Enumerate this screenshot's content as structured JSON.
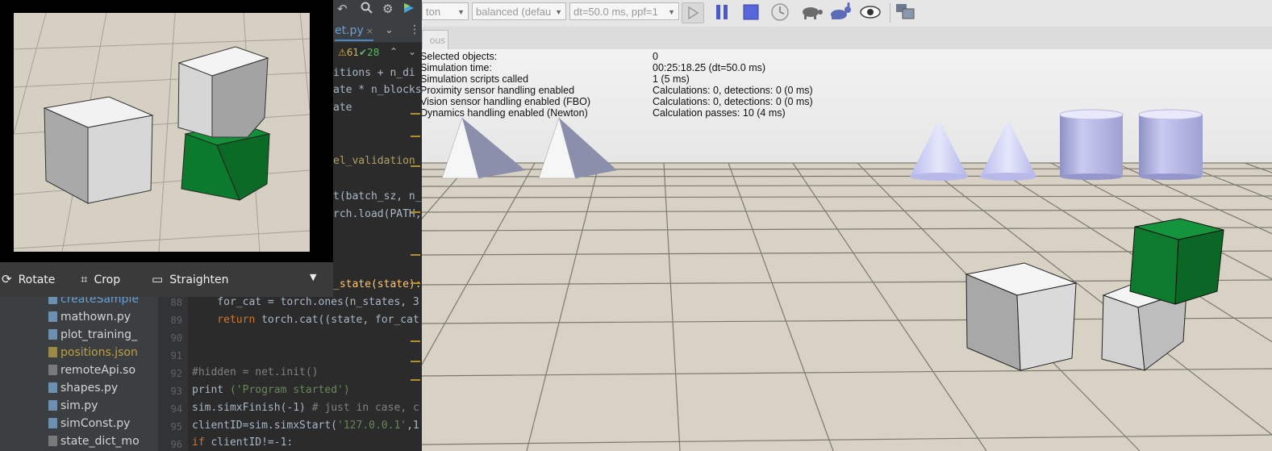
{
  "ide": {
    "file_tab": "et.py",
    "tab_close": "×",
    "warning_count": "61",
    "ok_count": "28",
    "code_lines": [
      {
        "text": "itions + n_di"
      },
      {
        "text": "ate * n_blocks"
      },
      {
        "text": "ate"
      },
      {
        "text": "el_validation"
      },
      {
        "text": "t(batch_sz, n_"
      },
      {
        "text": "rch.load(PATH,"
      },
      {
        "text": "_state(state):"
      }
    ],
    "line_numbers": [
      "88",
      "89",
      "90",
      "91",
      "92",
      "93",
      "94",
      "95",
      "96"
    ],
    "code_88": "    for_cat = torch.ones(n_states, 3",
    "code_89_kw": "    return",
    "code_89_rest": " torch.cat((state, for_cat",
    "code_92": "#hidden = net.init()",
    "code_93_fn": "print",
    "code_93_str": " ('Program started')",
    "code_94_a": "sim.simxFinish(-1)",
    "code_94_cm": " # just in case, c",
    "code_95_a": "clientID=sim.simxStart(",
    "code_95_str": "'127.0.0.1'",
    "code_95_b": ",1",
    "code_96_kw": "if",
    "code_96_rest": " clientID!=-1:",
    "files": [
      "createSample",
      "mathown.py",
      "plot_training_",
      "positions.json",
      "remoteApi.so",
      "shapes.py",
      "sim.py",
      "simConst.py",
      "state_dict_mo"
    ]
  },
  "viewer": {
    "rotate": "Rotate",
    "crop": "Crop",
    "straighten": "Straighten"
  },
  "sim": {
    "engine_combo": "ton",
    "mode_combo": "balanced (defau",
    "dt_combo": "dt=50.0 ms, ppf=1",
    "tab_label": "ous",
    "info": [
      {
        "label": "Selected objects:",
        "value": "0"
      },
      {
        "label": "Simulation time:",
        "value": "00:25:18.25 (dt=50.0 ms)"
      },
      {
        "label": "Simulation scripts called",
        "value": "1 (5 ms)"
      },
      {
        "label": "Proximity sensor handling enabled",
        "value": "Calculations: 0, detections: 0 (0 ms)"
      },
      {
        "label": "Vision sensor handling enabled (FBO)",
        "value": "Calculations: 0, detections: 0 (0 ms)"
      },
      {
        "label": "Dynamics handling enabled (Newton)",
        "value": "Calculation passes: 10 (4 ms)"
      }
    ]
  },
  "colors": {
    "green_cube": "#0d7a2e",
    "white_cube": "#d9d9d9",
    "floor": "#d4cdbd",
    "cone": "#c7c9f2"
  }
}
